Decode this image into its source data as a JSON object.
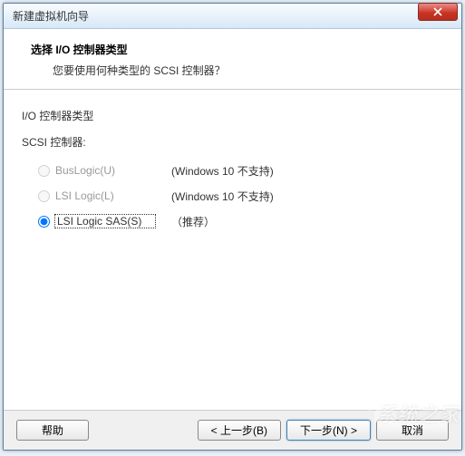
{
  "titlebar": {
    "title": "新建虚拟机向导"
  },
  "header": {
    "title": "选择 I/O 控制器类型",
    "subtitle": "您要使用何种类型的 SCSI 控制器？"
  },
  "content": {
    "section_label": "I/O 控制器类型",
    "sub_label": "SCSI 控制器:",
    "options": [
      {
        "label": "BusLogic(U)",
        "note": "(Windows 10 不支持)",
        "disabled": true,
        "selected": false
      },
      {
        "label": "LSI Logic(L)",
        "note": "(Windows 10 不支持)",
        "disabled": true,
        "selected": false
      },
      {
        "label": "LSI Logic SAS(S)",
        "note": "（推荐）",
        "disabled": false,
        "selected": true
      }
    ]
  },
  "footer": {
    "help": "帮助",
    "back": "< 上一步(B)",
    "next": "下一步(N) >",
    "cancel": "取消"
  },
  "watermark": {
    "text": "系统之家"
  }
}
